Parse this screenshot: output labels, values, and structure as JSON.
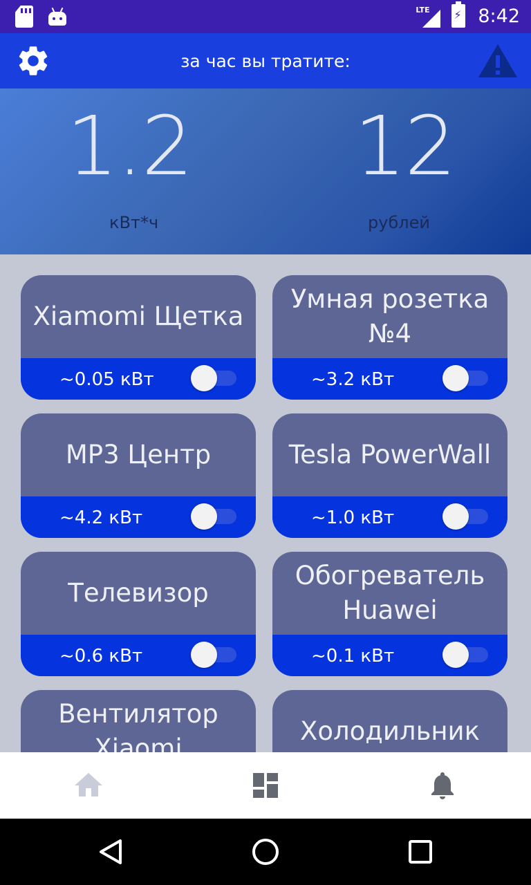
{
  "status_bar": {
    "network": "LTE",
    "time": "8:42"
  },
  "app_bar": {
    "title": "за час вы тратите:",
    "left_icon": "gear-icon",
    "right_icon": "warning-icon"
  },
  "summary": {
    "energy_value": "1.2",
    "energy_unit": "кВт*ч",
    "cost_value": "12",
    "cost_unit": "рублей"
  },
  "devices": [
    {
      "name": "Xiamomi Щетка",
      "power": "~0.05 кВт",
      "enabled": false
    },
    {
      "name": "Умная розетка №4",
      "power": "~3.2 кВт",
      "enabled": false
    },
    {
      "name": "MP3 Центр",
      "power": "~4.2 кВт",
      "enabled": false
    },
    {
      "name": "Tesla PowerWall",
      "power": "~1.0 кВт",
      "enabled": false
    },
    {
      "name": "Телевизор",
      "power": "~0.6 кВт",
      "enabled": false
    },
    {
      "name": "Обогреватель Huawei",
      "power": "~0.1 кВт",
      "enabled": false
    },
    {
      "name": "Вентилятор Xiaomi",
      "power": "",
      "enabled": false
    },
    {
      "name": "Холодильник",
      "power": "",
      "enabled": false
    }
  ],
  "bottom_nav": [
    {
      "icon": "home-icon",
      "active": false
    },
    {
      "icon": "dashboard-icon",
      "active": true
    },
    {
      "icon": "bell-icon",
      "active": true
    }
  ],
  "colors": {
    "status_bar": "#3c1fae",
    "app_bar": "#1a3fdf",
    "card_top": "#5d6694",
    "card_bottom": "#0533de",
    "background": "#c3c8d4"
  }
}
